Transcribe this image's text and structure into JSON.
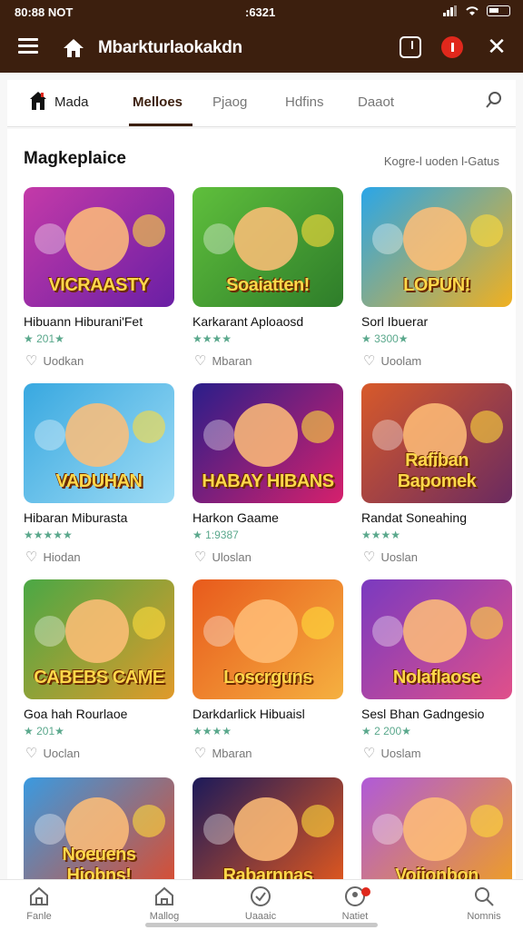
{
  "status": {
    "left": "80:88 NOT",
    "time": ":6321"
  },
  "appbar": {
    "title": "Mbarkturlaokakdn"
  },
  "tabs": [
    {
      "label": "Mada"
    },
    {
      "label": "Melloes"
    },
    {
      "label": "Pjaog"
    },
    {
      "label": "Hdfins"
    },
    {
      "label": "Daaot"
    }
  ],
  "section": {
    "title": "Magkeplaice",
    "link": "Kogre-l uoden l-Gatus"
  },
  "games": [
    {
      "name": "Hibuann Hiburani'Fet",
      "rating": "★ 201★",
      "wish": "Uodkan",
      "banner": "VICRAASTY",
      "colors": [
        "#c43aa8",
        "#6a1fa5"
      ]
    },
    {
      "name": "Karkarant Aploaosd",
      "rating": "★★★★",
      "wish": "Mbaran",
      "banner": "Soaiatten!",
      "colors": [
        "#5fbf3c",
        "#2e7d2a"
      ]
    },
    {
      "name": "Sorl Ibuerar",
      "rating": "★ 3300★",
      "wish": "Uoolam",
      "banner": "LOPUN!",
      "colors": [
        "#2aa6e8",
        "#f0b020"
      ]
    },
    {
      "name": "Hibaran Miburasta",
      "rating": "★★★★★",
      "wish": "Hiodan",
      "banner": "VADUHAN",
      "colors": [
        "#38a8e0",
        "#9fdcf5"
      ]
    },
    {
      "name": "Harkon Gaame",
      "rating": "★ 1:9387",
      "wish": "Uloslan",
      "banner": "HABAY HIBANS",
      "colors": [
        "#2a1e8a",
        "#d6206c"
      ]
    },
    {
      "name": "Randat Soneahing",
      "rating": "★★★★",
      "wish": "Uoslan",
      "banner": "Rafiban Bapomek",
      "colors": [
        "#d85a2a",
        "#6a2a60"
      ]
    },
    {
      "name": "Goa hah Rourlaoe",
      "rating": "★ 201★",
      "wish": "Uoclan",
      "banner": "CABEBS CAME",
      "colors": [
        "#4aa845",
        "#e09a2a"
      ]
    },
    {
      "name": "Darkdarlick Hibuaisl",
      "rating": "★★★★",
      "wish": "Mbaran",
      "banner": "Loscrguns",
      "colors": [
        "#e85a1c",
        "#f5b040"
      ]
    },
    {
      "name": "Sesl Bhan Gadngesio",
      "rating": "★ 2 200★",
      "wish": "Uoslam",
      "banner": "Nolaflaose",
      "colors": [
        "#7a3ac0",
        "#e0508a"
      ]
    },
    {
      "name": "",
      "rating": "",
      "wish": "",
      "banner": "Noeuens Hiobns!",
      "colors": [
        "#3a9ae0",
        "#e04a2a"
      ]
    },
    {
      "name": "",
      "rating": "",
      "wish": "",
      "banner": "Rabarnnas",
      "colors": [
        "#1c1a5a",
        "#e85a1c"
      ]
    },
    {
      "name": "",
      "rating": "",
      "wish": "",
      "banner": "Voijonbon",
      "colors": [
        "#b05ad8",
        "#f0a020"
      ]
    }
  ],
  "nav": [
    {
      "label": "Fanle"
    },
    {
      "label": "Mallog"
    },
    {
      "label": "Uaaaic"
    },
    {
      "label": "Natiet"
    },
    {
      "label": "Nomnis"
    }
  ]
}
